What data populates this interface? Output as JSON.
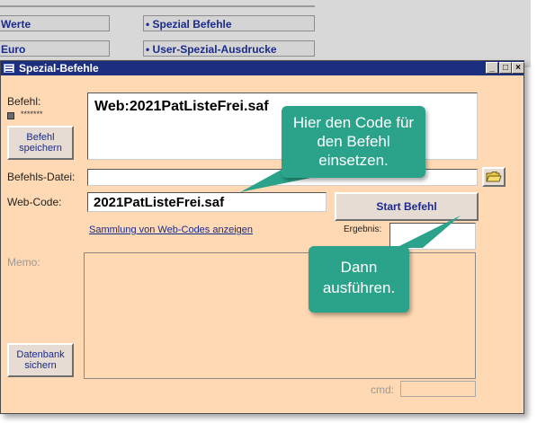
{
  "background": {
    "buttons": [
      "Werte",
      "Euro",
      "• Spezial Befehle",
      "• User-Spezial-Ausdrucke"
    ]
  },
  "window": {
    "title": "Spezial-Befehle",
    "controls": {
      "minimize": "_",
      "maximize": "□",
      "close": "×"
    }
  },
  "form": {
    "befehl_label": "Befehl:",
    "befehl_value": "Web:2021PatListeFrei.saf",
    "befehl_marker": "*******",
    "save_button_line1": "Befehl",
    "save_button_line2": "speichern",
    "befehls_datei_label": "Befehls-Datei:",
    "befehls_datei_value": "",
    "web_code_label": "Web-Code:",
    "web_code_value": "2021PatListeFrei.saf",
    "start_button": "Start Befehl",
    "sammlung_link": "Sammlung von Web-Codes anzeigen",
    "ergebnis_label": "Ergebnis:",
    "ergebnis_value": "",
    "memo_label": "Memo:",
    "memo_value": "",
    "datenbank_button_line1": "Datenbank",
    "datenbank_button_line2": "sichern",
    "cmd_label": "cmd:",
    "cmd_value": ""
  },
  "callouts": {
    "top": "Hier den Code für den Befehl einsetzen.",
    "bottom": "Dann ausführen."
  },
  "colors": {
    "dialog_bg": "#ffd9b3",
    "titlebar": "#1c2f7e",
    "callout": "#2aa38a",
    "link": "#1a2a8c"
  }
}
